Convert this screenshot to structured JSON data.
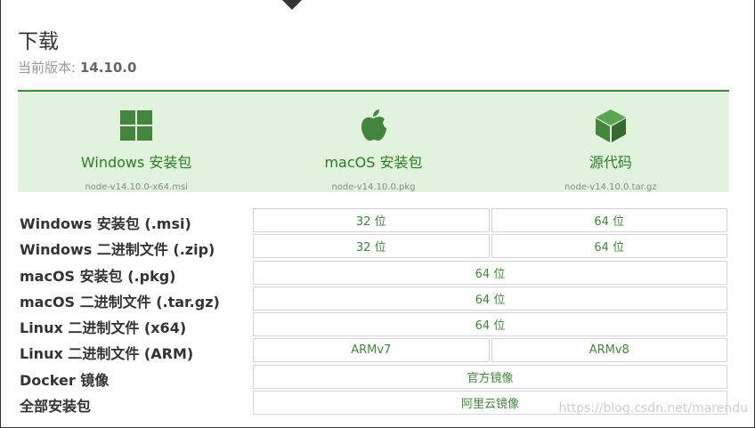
{
  "page": {
    "title": "下载",
    "version_label": "当前版本:",
    "version_value": "14.10.0"
  },
  "installers": [
    {
      "icon": "windows-icon",
      "label": "Windows 安装包",
      "file": "node-v14.10.0-x64.msi"
    },
    {
      "icon": "apple-icon",
      "label": "macOS 安装包",
      "file": "node-v14.10.0.pkg"
    },
    {
      "icon": "cube-icon",
      "label": "源代码",
      "file": "node-v14.10.0.tar.gz"
    }
  ],
  "rows": [
    {
      "label": "Windows 安装包 (.msi)",
      "cells": [
        "32 位",
        "64 位"
      ]
    },
    {
      "label": "Windows 二进制文件 (.zip)",
      "cells": [
        "32 位",
        "64 位"
      ]
    },
    {
      "label": "macOS 安装包 (.pkg)",
      "cells": [
        "64 位"
      ]
    },
    {
      "label": "macOS 二进制文件 (.tar.gz)",
      "cells": [
        "64 位"
      ]
    },
    {
      "label": "Linux 二进制文件 (x64)",
      "cells": [
        "64 位"
      ]
    },
    {
      "label": "Linux 二进制文件 (ARM)",
      "cells": [
        "ARMv7",
        "ARMv8"
      ]
    },
    {
      "label": "Docker 镜像",
      "cells": [
        "官方镜像"
      ]
    },
    {
      "label": "全部安装包",
      "cells": [
        "阿里云镜像"
      ]
    }
  ],
  "watermark": "https://blog.csdn.net/marendu",
  "colors": {
    "accent": "#43853d",
    "panel_bg": "#e1f3dc"
  }
}
